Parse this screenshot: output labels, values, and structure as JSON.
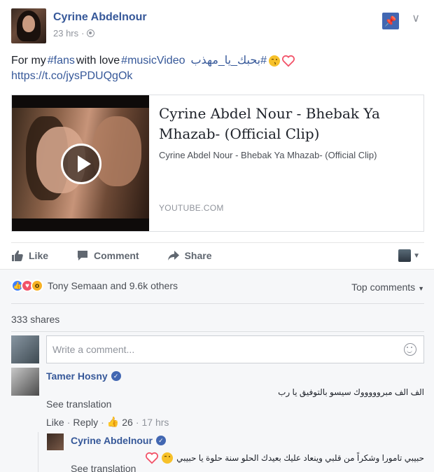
{
  "post": {
    "author": "Cyrine Abdelnour",
    "time": "23 hrs",
    "text_prefix": "For my ",
    "hashtag_fans": "#fans",
    "text_mid": " with love ",
    "hashtag_music": "#musicVideo",
    "hashtag_arabic": "#بحبك_يا_مهذب",
    "link": "https://t.co/jysPDUQgOk"
  },
  "link_card": {
    "title": "Cyrine Abdel Nour - Bhebak Ya Mhazab- (Official Clip)",
    "description": "Cyrine Abdel Nour - Bhebak Ya Mhazab- (Official Clip)",
    "domain": "YOUTUBE.COM"
  },
  "actions": {
    "like": "Like",
    "comment": "Comment",
    "share": "Share"
  },
  "reactions": {
    "summary": "Tony Semaan and 9.6k others",
    "top_comments": "Top comments"
  },
  "shares": "333 shares",
  "composer": {
    "placeholder": "Write a comment..."
  },
  "comment": {
    "author": "Tamer Hosny",
    "text": "الف الف مبروووووك سيسو بالتوفيق يا رب",
    "see_translation": "See translation",
    "like": "Like",
    "reply": "Reply",
    "likes_count": "26",
    "time": "17 hrs"
  },
  "reply": {
    "author": "Cyrine Abdelnour",
    "text": "حبيبي تامورا وشكراً من قلبي وينعاد عليك بعيدك الحلو سنة حلوة يا حبيبي",
    "see_translation": "See translation"
  },
  "colors": {
    "link_blue": "#365899",
    "fb_blue": "#4267b2",
    "muted": "#90949c",
    "love_red": "#f25268",
    "wow_yellow": "#f7b125"
  }
}
